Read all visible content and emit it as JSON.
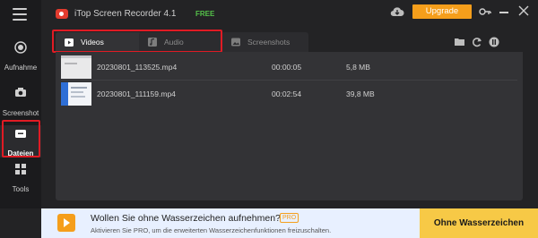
{
  "window": {
    "title": "iTop Screen Recorder 4.1",
    "edition": "FREE",
    "upgrade_label": "Upgrade"
  },
  "sidebar": {
    "items": [
      {
        "label": "Aufnahme",
        "icon": "record-icon"
      },
      {
        "label": "Screenshot",
        "icon": "camera-icon"
      },
      {
        "label": "Dateien",
        "icon": "folder-icon",
        "active": true
      },
      {
        "label": "Tools",
        "icon": "tools-icon"
      }
    ]
  },
  "tabs": [
    {
      "label": "Videos",
      "icon": "video-icon",
      "active": true
    },
    {
      "label": "Audio",
      "icon": "audio-icon"
    },
    {
      "label": "Screenshots",
      "icon": "image-icon"
    }
  ],
  "toolbar": {
    "icons": [
      "open-folder-icon",
      "refresh-icon",
      "compress-icon"
    ]
  },
  "files": [
    {
      "name": "20230801_113525.mp4",
      "duration": "00:00:05",
      "size": "5,8 MB"
    },
    {
      "name": "20230801_111159.mp4",
      "duration": "00:02:54",
      "size": "39,8 MB"
    }
  ],
  "banner": {
    "title": "Wollen Sie ohne Wasserzeichen aufnehmen?",
    "badge": "PRO",
    "subtitle": "Aktivieren Sie PRO, um die erweiterten Wasserzeichenfunktionen freizuschalten.",
    "button": "Ohne Wasserzeichen"
  },
  "colors": {
    "accent": "#f59e1b",
    "highlight_frame": "#e01b24",
    "free": "#55c24a"
  }
}
